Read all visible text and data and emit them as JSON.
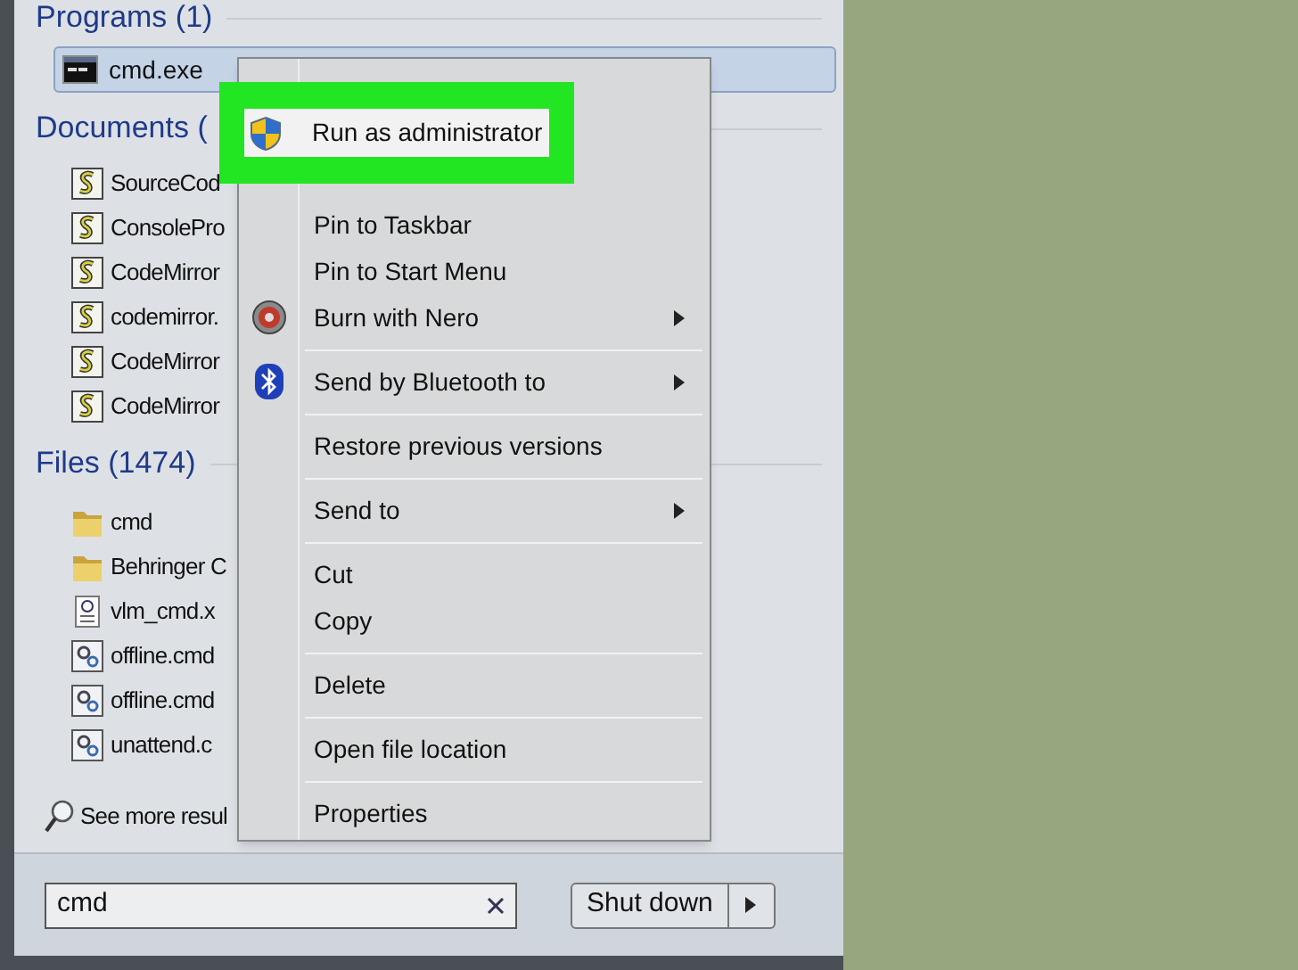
{
  "programs": {
    "heading": "Programs (1)",
    "items": [
      {
        "name": "cmd.exe",
        "selected": true
      }
    ]
  },
  "documents": {
    "heading": "Documents (",
    "items": [
      {
        "name": "SourceCod"
      },
      {
        "name": "ConsolePro"
      },
      {
        "name": "CodeMirror"
      },
      {
        "name": "codemirror."
      },
      {
        "name": "CodeMirror"
      },
      {
        "name": "CodeMirror"
      }
    ]
  },
  "files": {
    "heading": "Files (1474)",
    "items": [
      {
        "name": "cmd",
        "kind": "folder"
      },
      {
        "name": "Behringer C",
        "kind": "folder"
      },
      {
        "name": "vlm_cmd.x",
        "kind": "markup"
      },
      {
        "name": "offline.cmd",
        "kind": "settings"
      },
      {
        "name": "offline.cmd",
        "kind": "settings"
      },
      {
        "name": "unattend.c",
        "kind": "settings"
      }
    ]
  },
  "see_more": "See more resul",
  "search": {
    "value": "cmd"
  },
  "shutdown": {
    "label": "Shut down"
  },
  "context_menu": {
    "items": [
      {
        "kind": "covered"
      },
      {
        "kind": "covered"
      },
      {
        "kind": "covered"
      },
      {
        "kind": "item",
        "label": "Pin to Taskbar",
        "submenu": false
      },
      {
        "kind": "item",
        "label": "Pin to Start Menu",
        "submenu": false
      },
      {
        "kind": "disc",
        "label": "Burn with Nero",
        "submenu": true
      },
      {
        "kind": "separator"
      },
      {
        "kind": "bluetooth",
        "label": "Send by Bluetooth to",
        "submenu": true
      },
      {
        "kind": "separator"
      },
      {
        "kind": "item",
        "label": "Restore previous versions",
        "submenu": false
      },
      {
        "kind": "separator"
      },
      {
        "kind": "item",
        "label": "Send to",
        "submenu": true
      },
      {
        "kind": "separator"
      },
      {
        "kind": "item",
        "label": "Cut",
        "submenu": false
      },
      {
        "kind": "item",
        "label": "Copy",
        "submenu": false
      },
      {
        "kind": "separator"
      },
      {
        "kind": "item",
        "label": "Delete",
        "submenu": false
      },
      {
        "kind": "separator"
      },
      {
        "kind": "item",
        "label": "Open file location",
        "submenu": false
      },
      {
        "kind": "separator"
      },
      {
        "kind": "item",
        "label": "Properties",
        "submenu": false
      }
    ]
  },
  "callout": {
    "label": "Run as administrator"
  }
}
